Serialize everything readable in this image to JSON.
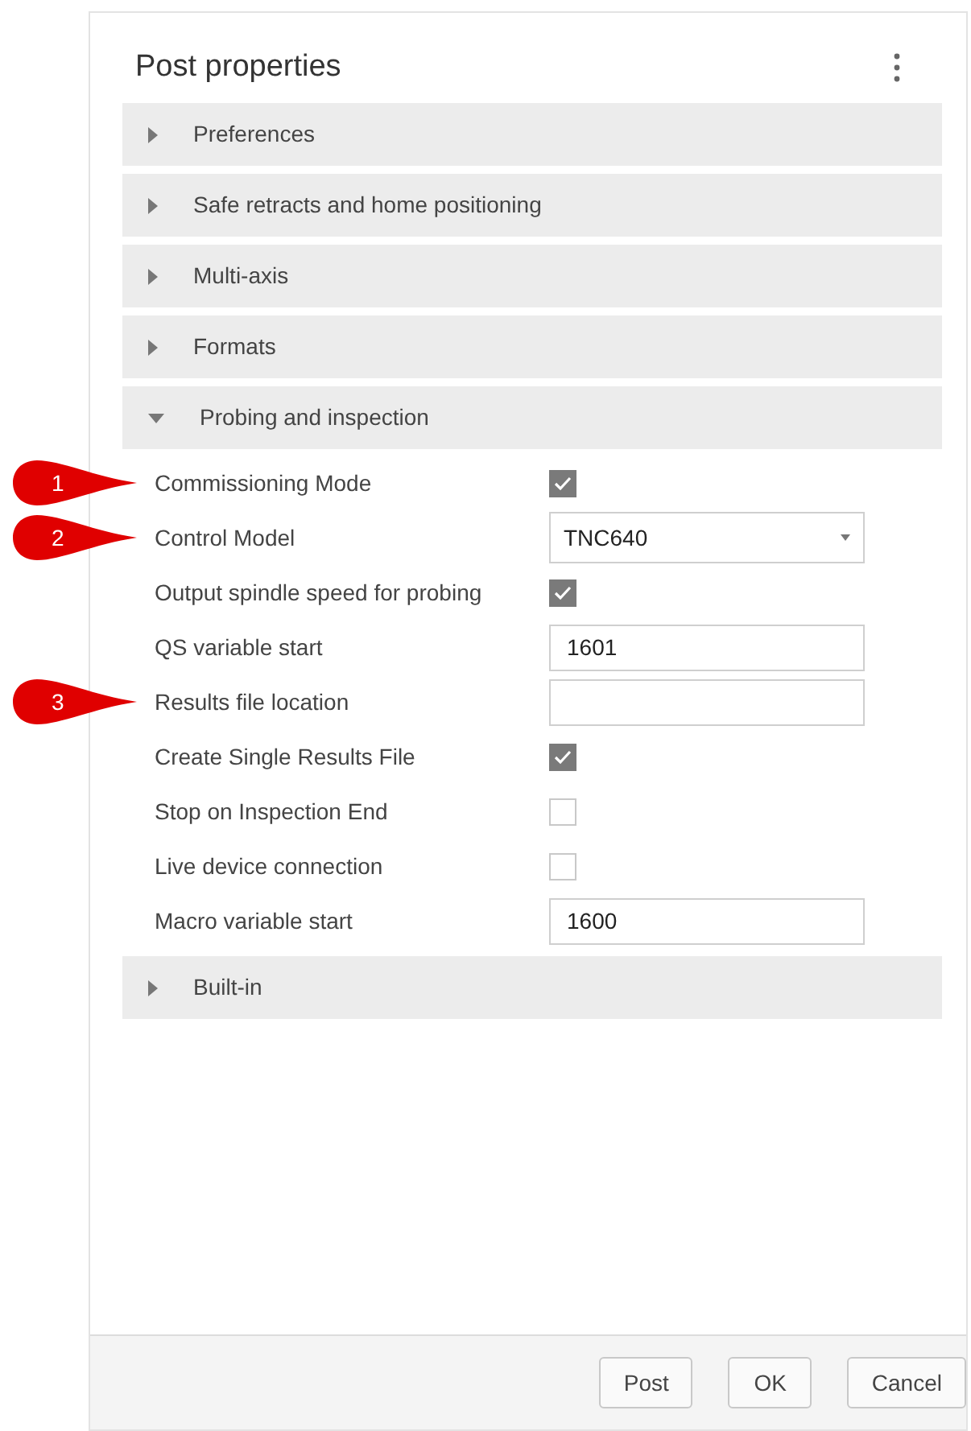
{
  "title": "Post properties",
  "sections": [
    {
      "label": "Preferences",
      "expanded": false
    },
    {
      "label": "Safe retracts and home positioning",
      "expanded": false
    },
    {
      "label": "Multi-axis",
      "expanded": false
    },
    {
      "label": "Formats",
      "expanded": false
    },
    {
      "label": "Probing and inspection",
      "expanded": true,
      "properties": [
        {
          "kind": "checkbox",
          "label": "Commissioning Mode",
          "checked": true,
          "callout": "1"
        },
        {
          "kind": "dropdown",
          "label": "Control Model",
          "value": "TNC640",
          "callout": "2"
        },
        {
          "kind": "checkbox",
          "label": "Output spindle speed for probing",
          "checked": true
        },
        {
          "kind": "text",
          "label": "QS variable start",
          "value": "1601"
        },
        {
          "kind": "text",
          "label": "Results file location",
          "callout": "3"
        },
        {
          "kind": "checkbox",
          "label": "Create Single Results File",
          "checked": true
        },
        {
          "kind": "checkbox",
          "label": "Stop on Inspection End",
          "checked": false
        },
        {
          "kind": "checkbox",
          "label": "Live device connection",
          "checked": false
        },
        {
          "kind": "text",
          "label": "Macro variable start",
          "value": "1600"
        }
      ]
    },
    {
      "label": "Built-in",
      "expanded": false
    }
  ],
  "buttons": [
    "Post",
    "OK",
    "Cancel"
  ]
}
